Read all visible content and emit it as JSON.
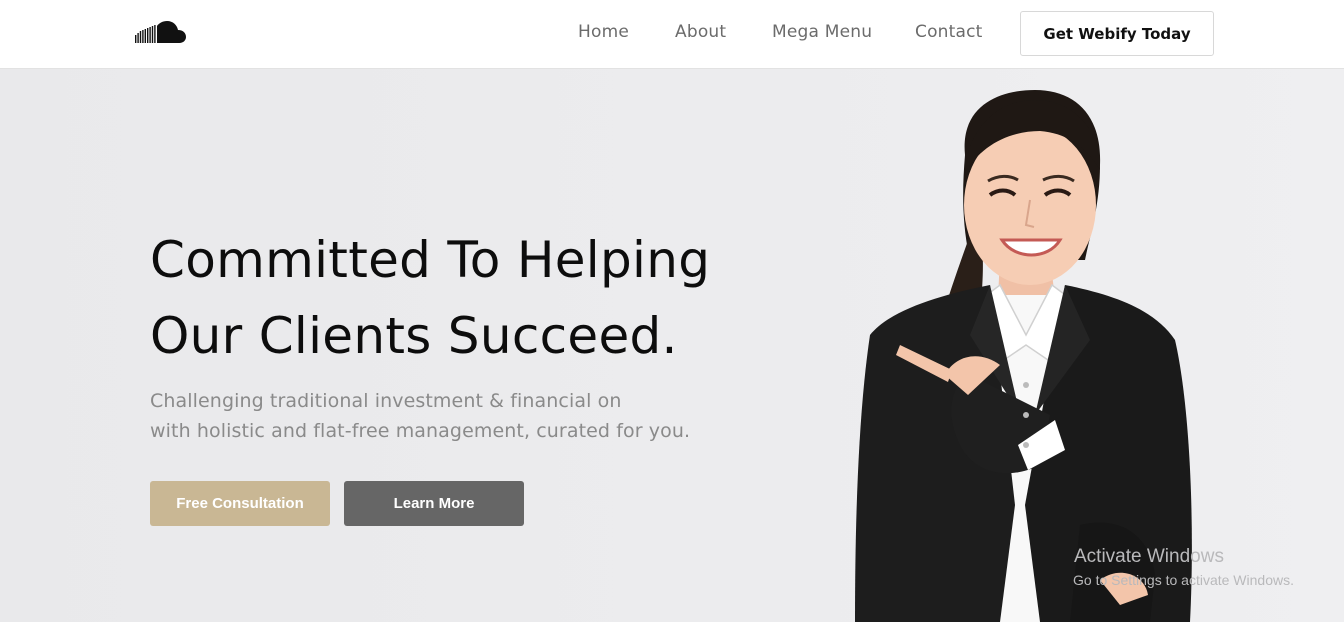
{
  "nav": {
    "logo_icon": "soundcloud-cloud-logo",
    "links": [
      "Home",
      "About",
      "Mega Menu",
      "Contact"
    ],
    "cta_label": "Get Webify Today"
  },
  "hero": {
    "title_line1": "Committed To Helping",
    "title_line2": "Our Clients Succeed.",
    "subtitle_line1": "Challenging traditional investment & financial on",
    "subtitle_line2": "with holistic and flat-free management, curated for you.",
    "primary_button": "Free Consultation",
    "secondary_button": "Learn More",
    "image": "smiling-businesswoman-pointing"
  },
  "watermark": {
    "title": "Activate Windows",
    "subtitle": "Go to Settings to activate Windows."
  },
  "colors": {
    "primary_button": "#c9b794",
    "secondary_button": "#666666",
    "hero_background": "#eaeaec"
  }
}
